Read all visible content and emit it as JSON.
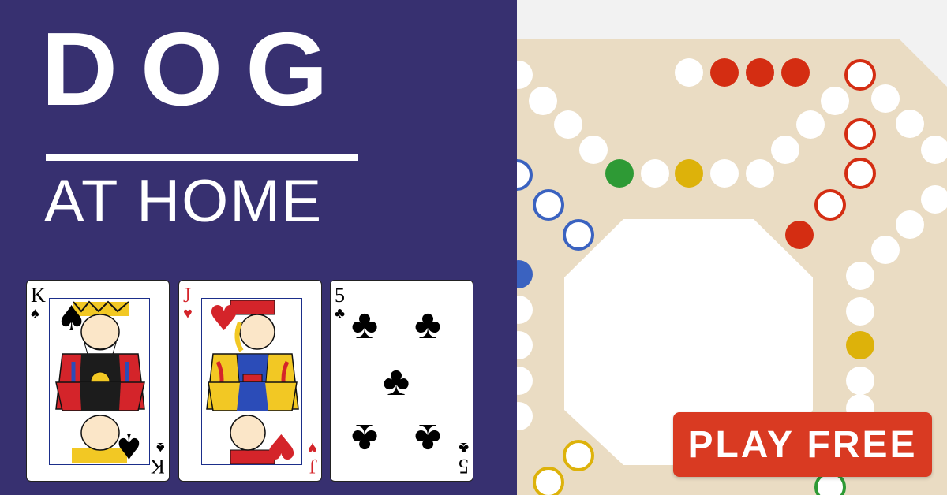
{
  "title": {
    "main": "DOG",
    "sub": "AT HOME"
  },
  "cta": {
    "label": "PLAY FREE"
  },
  "cards": [
    {
      "rank": "K",
      "suit": "♠",
      "suit_name": "spades",
      "color": "#000000",
      "type": "face"
    },
    {
      "rank": "J",
      "suit": "♥",
      "suit_name": "hearts",
      "color": "#d4242a",
      "type": "face"
    },
    {
      "rank": "5",
      "suit": "♣",
      "suit_name": "clubs",
      "color": "#000000",
      "type": "number"
    }
  ],
  "colors": {
    "panel": "#373070",
    "board": "#eadcc3",
    "hole": "#ffffff",
    "red": "#d42d12",
    "blue": "#3a62c0",
    "green": "#2e9a35",
    "yellow": "#ddb20a",
    "cta": "#d93a22"
  }
}
